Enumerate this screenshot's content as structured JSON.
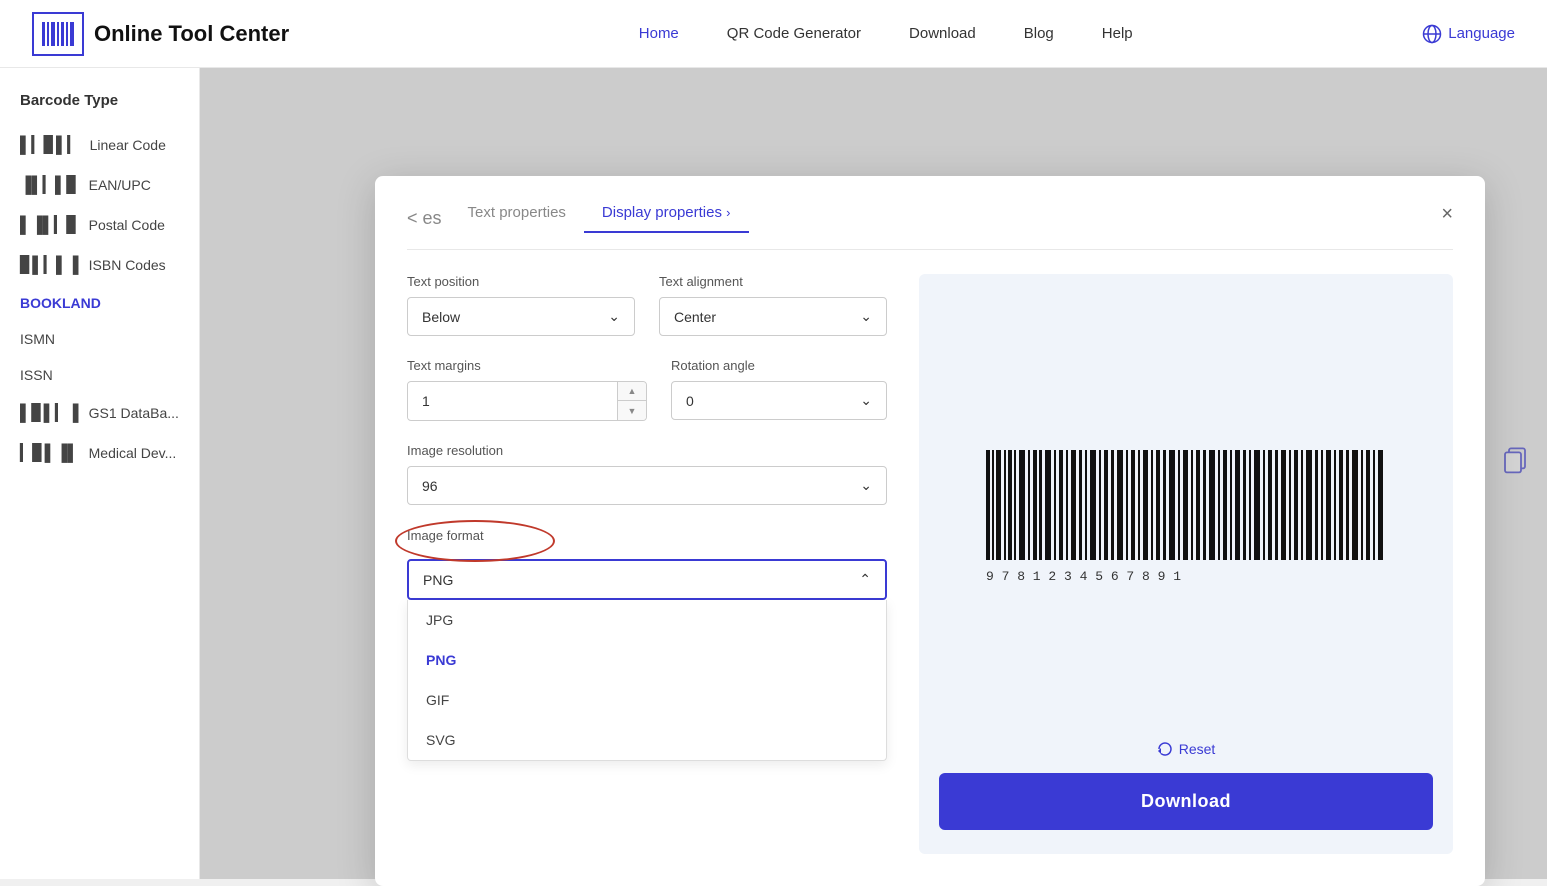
{
  "navbar": {
    "logo_text": "Online Tool Center",
    "links": [
      {
        "label": "Home",
        "active": true
      },
      {
        "label": "QR Code Generator",
        "active": false
      },
      {
        "label": "Download",
        "active": false
      },
      {
        "label": "Blog",
        "active": false
      },
      {
        "label": "Help",
        "active": false
      }
    ],
    "language_label": "Language"
  },
  "sidebar": {
    "title": "Barcode Type",
    "items": [
      {
        "label": "Linear Code",
        "icon": "barcode"
      },
      {
        "label": "EAN/UPC",
        "icon": "barcode"
      },
      {
        "label": "Postal Code",
        "icon": "barcode"
      },
      {
        "label": "ISBN Codes",
        "icon": "barcode"
      },
      {
        "label": "BOOKLAND",
        "icon": "",
        "active": true
      },
      {
        "label": "ISMN",
        "icon": ""
      },
      {
        "label": "ISSN",
        "icon": ""
      },
      {
        "label": "GS1 DataBa...",
        "icon": "barcode"
      },
      {
        "label": "Medical Dev...",
        "icon": "barcode"
      }
    ]
  },
  "modal": {
    "prev_tab": "< es",
    "tab_text": "Text properties",
    "tab_active": "Display properties",
    "close_label": "×",
    "text_position_label": "Text position",
    "text_position_value": "Below",
    "text_alignment_label": "Text alignment",
    "text_alignment_value": "Center",
    "text_margins_label": "Text margins",
    "text_margins_value": "1",
    "rotation_angle_label": "Rotation angle",
    "rotation_angle_value": "0",
    "image_resolution_label": "Image resolution",
    "image_resolution_value": "96",
    "image_format_label": "Image format",
    "image_format_value": "PNG",
    "format_options": [
      {
        "label": "JPG",
        "selected": false
      },
      {
        "label": "PNG",
        "selected": true
      },
      {
        "label": "GIF",
        "selected": false
      },
      {
        "label": "SVG",
        "selected": false
      }
    ],
    "reset_label": "Reset",
    "download_label": "Download"
  },
  "barcode": {
    "numbers": "9 7 8 1 2 3 4 5 6 7 8 9 1"
  }
}
